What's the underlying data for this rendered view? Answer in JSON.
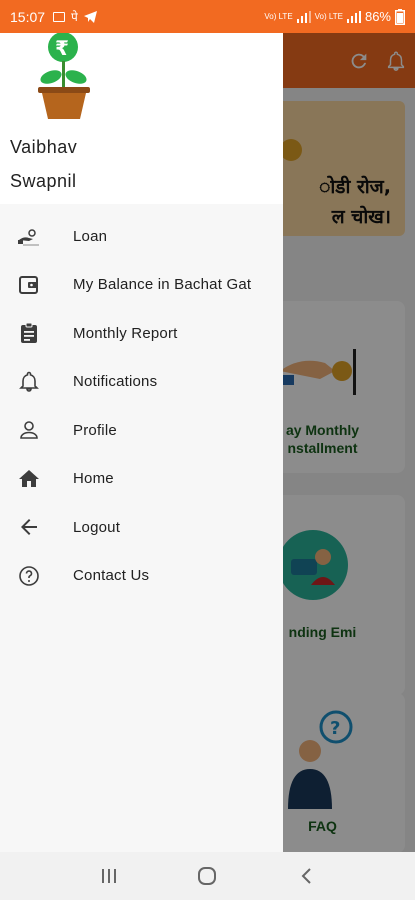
{
  "status_bar": {
    "time": "15:07",
    "carrier_glyph": "पे",
    "network_1": "Vo) LTE",
    "network_2": "Vo) LTE",
    "battery": "86%"
  },
  "background_app": {
    "banner_line_1": "ोडी रोज,",
    "banner_line_2": "ल चोख।",
    "card_installment_line_1": "ay Monthly",
    "card_installment_line_2": "nstallment",
    "card_pending": "nding Emi",
    "card_faq": "FAQ"
  },
  "drawer": {
    "user_first_name": "Vaibhav",
    "user_last_name": "Swapnil",
    "menu_items": [
      {
        "label": "Loan",
        "icon": "loan-hand-icon"
      },
      {
        "label": "My Balance in Bachat Gat",
        "icon": "wallet-icon"
      },
      {
        "label": "Monthly Report",
        "icon": "clipboard-icon"
      },
      {
        "label": "Notifications",
        "icon": "bell-icon"
      },
      {
        "label": "Profile",
        "icon": "person-icon"
      },
      {
        "label": "Home",
        "icon": "home-icon"
      },
      {
        "label": "Logout",
        "icon": "arrow-left-icon"
      },
      {
        "label": "Contact Us",
        "icon": "help-circle-icon"
      }
    ]
  },
  "colors": {
    "accent": "#f26a21",
    "logo_green": "#2bb24c",
    "pot_brown": "#b5651d"
  }
}
